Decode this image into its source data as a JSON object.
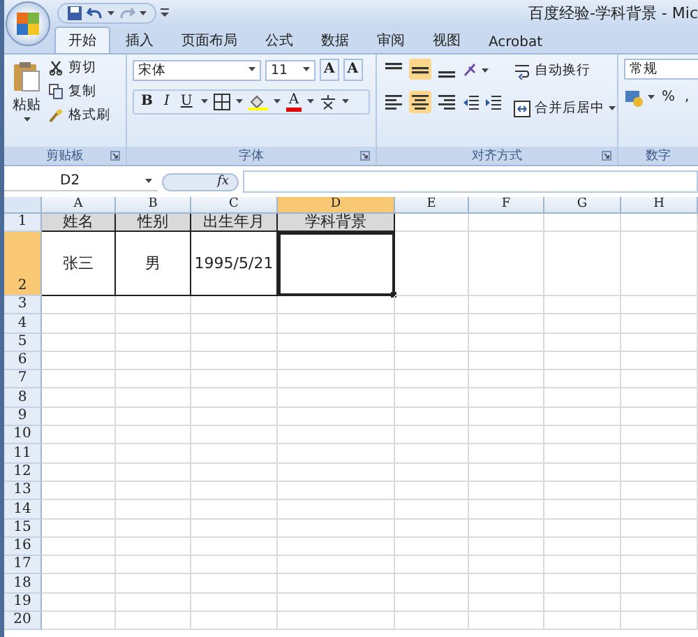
{
  "window": {
    "title": "百度经验-学科背景 - Mic"
  },
  "tabs": [
    {
      "label": "开始",
      "selected": true
    },
    {
      "label": "插入",
      "selected": false
    },
    {
      "label": "页面布局",
      "selected": false
    },
    {
      "label": "公式",
      "selected": false
    },
    {
      "label": "数据",
      "selected": false
    },
    {
      "label": "审阅",
      "selected": false
    },
    {
      "label": "视图",
      "selected": false
    },
    {
      "label": "Acrobat",
      "selected": false
    }
  ],
  "ribbon": {
    "clipboard": {
      "label": "剪贴板",
      "paste": "粘贴",
      "commands": [
        "剪切",
        "复制",
        "格式刷"
      ]
    },
    "font": {
      "label": "字体",
      "font_name": "宋体",
      "font_size": "11",
      "grow": "A",
      "shrink": "A",
      "bold": "B",
      "italic": "I",
      "underline": "U",
      "font_color": "A"
    },
    "alignment": {
      "label": "对齐方式",
      "vertical": [
        {
          "selected": false
        },
        {
          "selected": true
        },
        {
          "selected": false
        }
      ],
      "horizontal": [
        {
          "selected": false
        },
        {
          "selected": true
        },
        {
          "selected": false
        }
      ],
      "wrap": "自动换行",
      "merge": "合并后居中"
    },
    "number": {
      "label": "数字",
      "format": "常规",
      "percent": "%",
      "comma": ","
    }
  },
  "formula_bar": {
    "name_box": "D2",
    "function_label": "fx"
  },
  "sheet": {
    "columns": [
      {
        "label": "A",
        "selected": false
      },
      {
        "label": "B",
        "selected": false
      },
      {
        "label": "C",
        "selected": false
      },
      {
        "label": "D",
        "selected": true
      },
      {
        "label": "E",
        "selected": false
      },
      {
        "label": "F",
        "selected": false
      },
      {
        "label": "G",
        "selected": false
      },
      {
        "label": "H",
        "selected": false
      }
    ],
    "rows": [
      {
        "label": "1",
        "kind": "header",
        "selected": false,
        "cells": [
          "姓名",
          "性别",
          "出生年月",
          "学科背景"
        ]
      },
      {
        "label": "2",
        "kind": "data",
        "selected": true,
        "cells": [
          "张三",
          "男",
          "1995/5/21"
        ]
      },
      {
        "label": "3",
        "kind": "empty",
        "selected": false
      },
      {
        "label": "4",
        "kind": "empty",
        "selected": false
      },
      {
        "label": "5",
        "kind": "empty",
        "selected": false
      },
      {
        "label": "6",
        "kind": "empty",
        "selected": false
      },
      {
        "label": "7",
        "kind": "empty",
        "selected": false
      },
      {
        "label": "8",
        "kind": "empty",
        "selected": false
      },
      {
        "label": "9",
        "kind": "empty",
        "selected": false
      },
      {
        "label": "10",
        "kind": "empty",
        "selected": false
      },
      {
        "label": "11",
        "kind": "empty",
        "selected": false
      },
      {
        "label": "12",
        "kind": "empty",
        "selected": false
      },
      {
        "label": "13",
        "kind": "empty",
        "selected": false
      },
      {
        "label": "14",
        "kind": "empty",
        "selected": false
      },
      {
        "label": "15",
        "kind": "empty",
        "selected": false
      },
      {
        "label": "16",
        "kind": "empty",
        "selected": false
      },
      {
        "label": "17",
        "kind": "empty",
        "selected": false
      },
      {
        "label": "18",
        "kind": "empty",
        "selected": false
      },
      {
        "label": "19",
        "kind": "empty",
        "selected": false
      },
      {
        "label": "20",
        "kind": "empty",
        "selected": false
      }
    ]
  }
}
